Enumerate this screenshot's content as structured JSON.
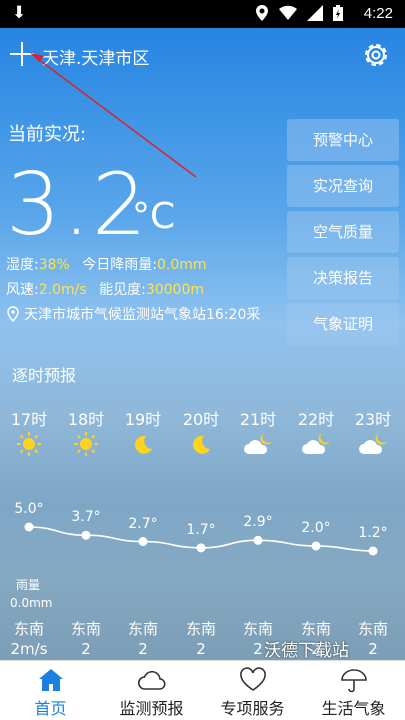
{
  "status_bar": {
    "time": "4:22"
  },
  "header": {
    "location": "天津.天津市区"
  },
  "current": {
    "label": "当前实况:",
    "temperature": "3.2",
    "unit": "°C",
    "humidity_label": "湿度:",
    "humidity_value": "38%",
    "rain_today_label": "今日降雨量:",
    "rain_today_value": "0.0mm",
    "wind_label": "风速:",
    "wind_value": "2.0m/s",
    "visibility_label": "能见度:",
    "visibility_value": "30000m",
    "station": "天津市城市气候监测站气象站16:20采"
  },
  "side_buttons": [
    "预警中心",
    "实况查询",
    "空气质量",
    "决策报告",
    "气象证明"
  ],
  "hourly": {
    "title": "逐时预报",
    "rain_label": "雨量",
    "rain_value": "0.0mm",
    "hours": [
      {
        "time": "17时",
        "icon": "sun-icon",
        "temp": "5.0°",
        "temp_num": 5.0,
        "dir": "东南",
        "speed": "2m/s"
      },
      {
        "time": "18时",
        "icon": "sun-icon",
        "temp": "3.7°",
        "temp_num": 3.7,
        "dir": "东南",
        "speed": "2"
      },
      {
        "time": "19时",
        "icon": "moon-icon",
        "temp": "2.7°",
        "temp_num": 2.7,
        "dir": "东南",
        "speed": "2"
      },
      {
        "time": "20时",
        "icon": "moon-icon",
        "temp": "1.7°",
        "temp_num": 1.7,
        "dir": "东南",
        "speed": "2"
      },
      {
        "time": "21时",
        "icon": "cloudy-night-icon",
        "temp": "2.9°",
        "temp_num": 2.9,
        "dir": "东南",
        "speed": "2"
      },
      {
        "time": "22时",
        "icon": "cloudy-night-icon",
        "temp": "2.0°",
        "temp_num": 2.0,
        "dir": "东南",
        "speed": "2"
      },
      {
        "time": "23时",
        "icon": "cloudy-night-icon",
        "temp": "1.2°",
        "temp_num": 1.2,
        "dir": "东南",
        "speed": "2"
      }
    ]
  },
  "watermark": "沃德下载站",
  "nav": [
    {
      "label": "首页",
      "icon": "home-icon",
      "active": true
    },
    {
      "label": "监测预报",
      "icon": "cloud-icon",
      "active": false
    },
    {
      "label": "专项服务",
      "icon": "heart-icon",
      "active": false
    },
    {
      "label": "生活气象",
      "icon": "umbrella-icon",
      "active": false
    }
  ],
  "colors": {
    "accent": "#1a7fe0",
    "highlight": "#ffe34a",
    "annotation": "#d9252b"
  }
}
